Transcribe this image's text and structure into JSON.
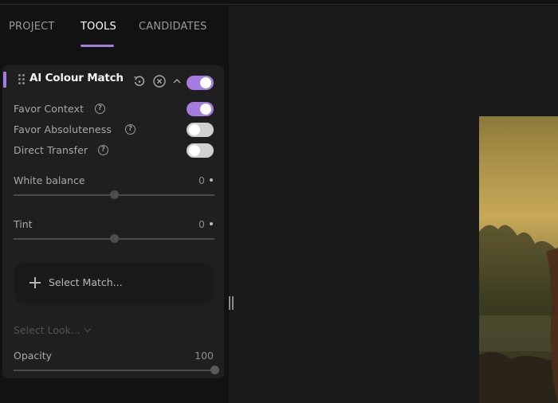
{
  "tabs": [
    {
      "label": "PROJECT",
      "active": false
    },
    {
      "label": "TOOLS",
      "active": true
    },
    {
      "label": "CANDIDATES",
      "active": false
    }
  ],
  "accent_color": "#a57ce0",
  "panel": {
    "title": "AI Colour Match",
    "enabled": true,
    "header_icons": [
      "reset-icon",
      "remove-icon",
      "collapse-chevron-up-icon"
    ],
    "options": [
      {
        "label": "Favor Context",
        "enabled": true
      },
      {
        "label": "Favor Absoluteness",
        "enabled": false
      },
      {
        "label": "Direct Transfer",
        "enabled": false
      }
    ],
    "sliders": [
      {
        "label": "White balance",
        "value": "0",
        "min": -100,
        "max": 100,
        "current": 0
      },
      {
        "label": "Tint",
        "value": "0",
        "min": -100,
        "max": 100,
        "current": 0
      }
    ],
    "select_match_label": "Select Match...",
    "select_look_label": "Select Look...",
    "opacity": {
      "label": "Opacity",
      "value": "100",
      "min": 0,
      "max": 100,
      "current": 100
    }
  },
  "canvas": {
    "image_description": "painting preview (partially visible)"
  }
}
